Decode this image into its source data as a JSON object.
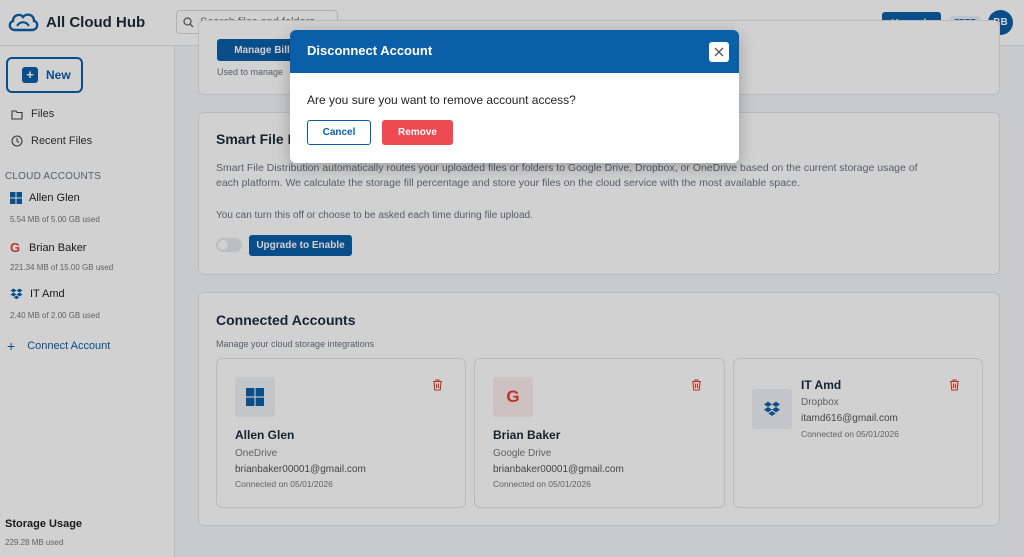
{
  "app": {
    "name": "All Cloud Hub"
  },
  "header": {
    "search_placeholder": "Search files and folders...",
    "upgrade_label": "Upgrade",
    "plan_badge": "FREE",
    "avatar_initials": "BB"
  },
  "sidebar": {
    "new_label": "New",
    "nav": [
      {
        "label": "Files",
        "icon": "folder-icon"
      },
      {
        "label": "Recent Files",
        "icon": "clock-icon"
      }
    ],
    "cloud_accounts_label": "CLOUD ACCOUNTS",
    "accounts": [
      {
        "name": "Allen Glen",
        "usage": "5.54 MB of 5.00 GB used",
        "icon": "onedrive-windows-icon"
      },
      {
        "name": "Brian Baker",
        "usage": "221.34 MB of 15.00 GB used",
        "icon": "google-icon"
      },
      {
        "name": "IT Amd",
        "usage": "2.40 MB of 2.00 GB used",
        "icon": "dropbox-icon"
      }
    ],
    "connect_label": "Connect Account",
    "storage_label": "Storage Usage",
    "storage_value": "229.28 MB used"
  },
  "billing": {
    "manage_label": "Manage Bill",
    "used_text": "Used to manage"
  },
  "smart": {
    "title": "Smart File D",
    "desc1": "Smart File Distribution automatically routes your uploaded files or folders to Google Drive, Dropbox, or OneDrive based on the current storage usage of",
    "desc2": "each platform. We calculate the storage fill percentage and store your files on the cloud service with the most available space.",
    "note": "You can turn this off or choose to be asked each time during file upload.",
    "upgrade_label": "Upgrade to Enable"
  },
  "connected": {
    "title": "Connected Accounts",
    "subtitle": "Manage your cloud storage integrations",
    "cards": [
      {
        "name": "Allen Glen",
        "service": "OneDrive",
        "email": "brianbaker00001@gmail.com",
        "connected": "Connected on 05/01/2026"
      },
      {
        "name": "Brian Baker",
        "service": "Google Drive",
        "email": "brianbaker00001@gmail.com",
        "connected": "Connected on 05/01/2026"
      },
      {
        "name": "IT Amd",
        "service": "Dropbox",
        "email": "itamd616@gmail.com",
        "connected": "Connected on 05/01/2026"
      }
    ]
  },
  "modal": {
    "title": "Disconnect Account",
    "message": "Are you sure you want to remove account access?",
    "cancel_label": "Cancel",
    "remove_label": "Remove"
  },
  "colors": {
    "primary": "#0b5ea8",
    "danger": "#ef4a52"
  }
}
